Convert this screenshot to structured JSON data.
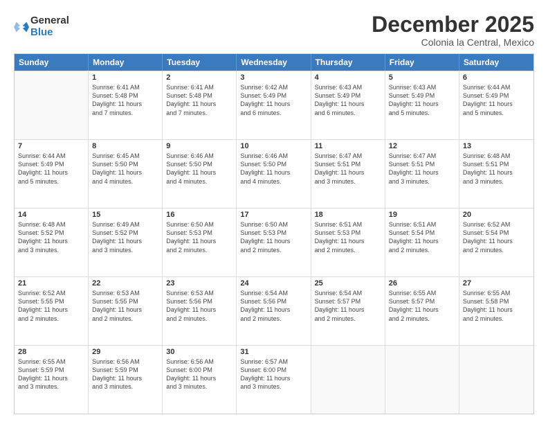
{
  "logo": {
    "general": "General",
    "blue": "Blue"
  },
  "title": "December 2025",
  "subtitle": "Colonia la Central, Mexico",
  "header_days": [
    "Sunday",
    "Monday",
    "Tuesday",
    "Wednesday",
    "Thursday",
    "Friday",
    "Saturday"
  ],
  "weeks": [
    [
      {
        "day": "",
        "info": ""
      },
      {
        "day": "1",
        "info": "Sunrise: 6:41 AM\nSunset: 5:48 PM\nDaylight: 11 hours\nand 7 minutes."
      },
      {
        "day": "2",
        "info": "Sunrise: 6:41 AM\nSunset: 5:48 PM\nDaylight: 11 hours\nand 7 minutes."
      },
      {
        "day": "3",
        "info": "Sunrise: 6:42 AM\nSunset: 5:49 PM\nDaylight: 11 hours\nand 6 minutes."
      },
      {
        "day": "4",
        "info": "Sunrise: 6:43 AM\nSunset: 5:49 PM\nDaylight: 11 hours\nand 6 minutes."
      },
      {
        "day": "5",
        "info": "Sunrise: 6:43 AM\nSunset: 5:49 PM\nDaylight: 11 hours\nand 5 minutes."
      },
      {
        "day": "6",
        "info": "Sunrise: 6:44 AM\nSunset: 5:49 PM\nDaylight: 11 hours\nand 5 minutes."
      }
    ],
    [
      {
        "day": "7",
        "info": "Sunrise: 6:44 AM\nSunset: 5:49 PM\nDaylight: 11 hours\nand 5 minutes."
      },
      {
        "day": "8",
        "info": "Sunrise: 6:45 AM\nSunset: 5:50 PM\nDaylight: 11 hours\nand 4 minutes."
      },
      {
        "day": "9",
        "info": "Sunrise: 6:46 AM\nSunset: 5:50 PM\nDaylight: 11 hours\nand 4 minutes."
      },
      {
        "day": "10",
        "info": "Sunrise: 6:46 AM\nSunset: 5:50 PM\nDaylight: 11 hours\nand 4 minutes."
      },
      {
        "day": "11",
        "info": "Sunrise: 6:47 AM\nSunset: 5:51 PM\nDaylight: 11 hours\nand 3 minutes."
      },
      {
        "day": "12",
        "info": "Sunrise: 6:47 AM\nSunset: 5:51 PM\nDaylight: 11 hours\nand 3 minutes."
      },
      {
        "day": "13",
        "info": "Sunrise: 6:48 AM\nSunset: 5:51 PM\nDaylight: 11 hours\nand 3 minutes."
      }
    ],
    [
      {
        "day": "14",
        "info": "Sunrise: 6:48 AM\nSunset: 5:52 PM\nDaylight: 11 hours\nand 3 minutes."
      },
      {
        "day": "15",
        "info": "Sunrise: 6:49 AM\nSunset: 5:52 PM\nDaylight: 11 hours\nand 3 minutes."
      },
      {
        "day": "16",
        "info": "Sunrise: 6:50 AM\nSunset: 5:53 PM\nDaylight: 11 hours\nand 2 minutes."
      },
      {
        "day": "17",
        "info": "Sunrise: 6:50 AM\nSunset: 5:53 PM\nDaylight: 11 hours\nand 2 minutes."
      },
      {
        "day": "18",
        "info": "Sunrise: 6:51 AM\nSunset: 5:53 PM\nDaylight: 11 hours\nand 2 minutes."
      },
      {
        "day": "19",
        "info": "Sunrise: 6:51 AM\nSunset: 5:54 PM\nDaylight: 11 hours\nand 2 minutes."
      },
      {
        "day": "20",
        "info": "Sunrise: 6:52 AM\nSunset: 5:54 PM\nDaylight: 11 hours\nand 2 minutes."
      }
    ],
    [
      {
        "day": "21",
        "info": "Sunrise: 6:52 AM\nSunset: 5:55 PM\nDaylight: 11 hours\nand 2 minutes."
      },
      {
        "day": "22",
        "info": "Sunrise: 6:53 AM\nSunset: 5:55 PM\nDaylight: 11 hours\nand 2 minutes."
      },
      {
        "day": "23",
        "info": "Sunrise: 6:53 AM\nSunset: 5:56 PM\nDaylight: 11 hours\nand 2 minutes."
      },
      {
        "day": "24",
        "info": "Sunrise: 6:54 AM\nSunset: 5:56 PM\nDaylight: 11 hours\nand 2 minutes."
      },
      {
        "day": "25",
        "info": "Sunrise: 6:54 AM\nSunset: 5:57 PM\nDaylight: 11 hours\nand 2 minutes."
      },
      {
        "day": "26",
        "info": "Sunrise: 6:55 AM\nSunset: 5:57 PM\nDaylight: 11 hours\nand 2 minutes."
      },
      {
        "day": "27",
        "info": "Sunrise: 6:55 AM\nSunset: 5:58 PM\nDaylight: 11 hours\nand 2 minutes."
      }
    ],
    [
      {
        "day": "28",
        "info": "Sunrise: 6:55 AM\nSunset: 5:59 PM\nDaylight: 11 hours\nand 3 minutes."
      },
      {
        "day": "29",
        "info": "Sunrise: 6:56 AM\nSunset: 5:59 PM\nDaylight: 11 hours\nand 3 minutes."
      },
      {
        "day": "30",
        "info": "Sunrise: 6:56 AM\nSunset: 6:00 PM\nDaylight: 11 hours\nand 3 minutes."
      },
      {
        "day": "31",
        "info": "Sunrise: 6:57 AM\nSunset: 6:00 PM\nDaylight: 11 hours\nand 3 minutes."
      },
      {
        "day": "",
        "info": ""
      },
      {
        "day": "",
        "info": ""
      },
      {
        "day": "",
        "info": ""
      }
    ]
  ]
}
